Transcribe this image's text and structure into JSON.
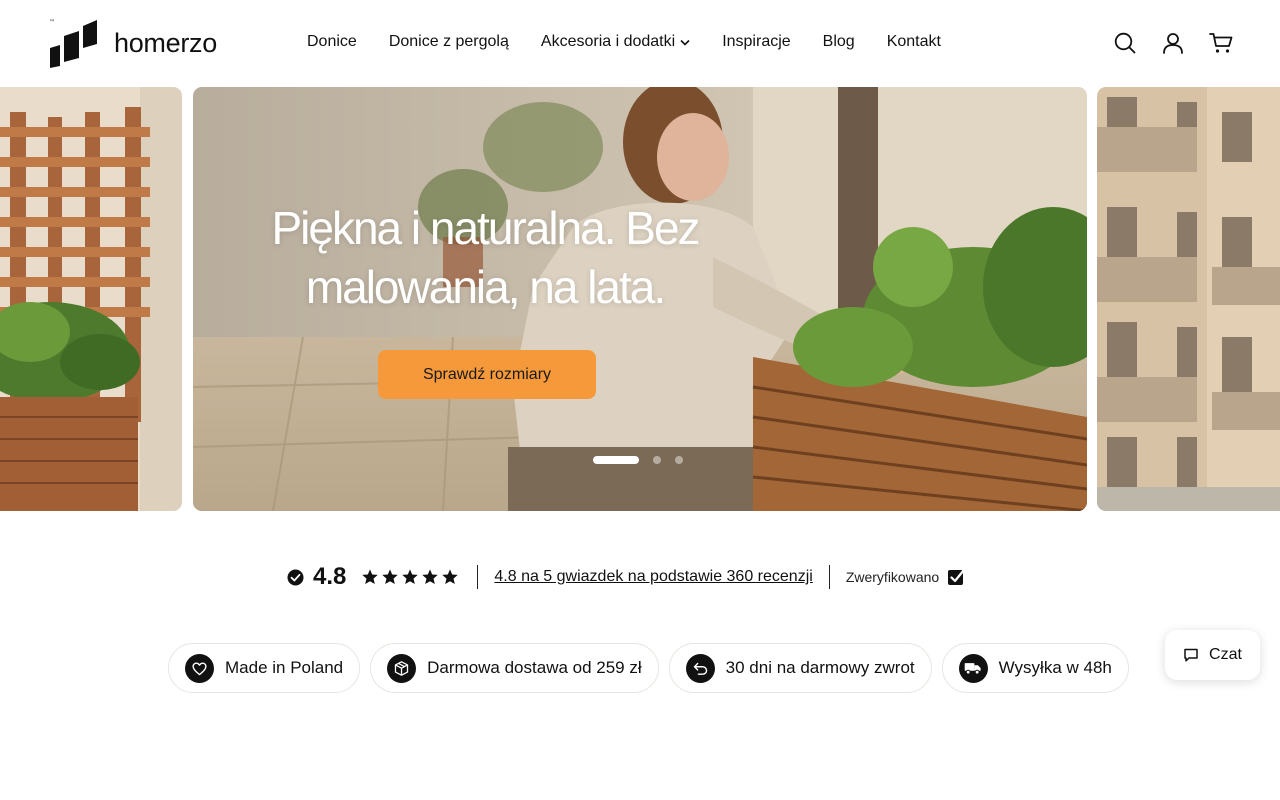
{
  "brand": {
    "name": "homerzo",
    "trademark": "™"
  },
  "nav": {
    "items": [
      {
        "label": "Donice"
      },
      {
        "label": "Donice z pergolą"
      },
      {
        "label": "Akcesoria i dodatki",
        "dropdown": true
      },
      {
        "label": "Inspiracje"
      },
      {
        "label": "Blog"
      },
      {
        "label": "Kontakt"
      }
    ]
  },
  "header_icons": [
    "search-icon",
    "user-icon",
    "cart-icon"
  ],
  "hero": {
    "headline_line1": "Piękna i naturalna. Bez",
    "headline_line2": "malowania, na lata.",
    "cta_label": "Sprawdź rozmiary",
    "slides_count": 3,
    "active_slide": 1
  },
  "rating": {
    "score": "4.8",
    "stars": 5,
    "summary_link": "4.8 na 5 gwiazdek na podstawie 360 recenzji",
    "verified_label": "Zweryfikowano"
  },
  "features": [
    {
      "icon": "heart-icon",
      "label": "Made in Poland"
    },
    {
      "icon": "package-icon",
      "label": "Darmowa dostawa od 259 zł"
    },
    {
      "icon": "return-icon",
      "label": "30 dni na darmowy zwrot"
    },
    {
      "icon": "truck-icon",
      "label": "Wysyłka w 48h"
    }
  ],
  "chat": {
    "label": "Czat",
    "icon": "chat-bubble-icon"
  },
  "colors": {
    "accent": "#f6993b",
    "text": "#111111",
    "background": "#ffffff"
  }
}
